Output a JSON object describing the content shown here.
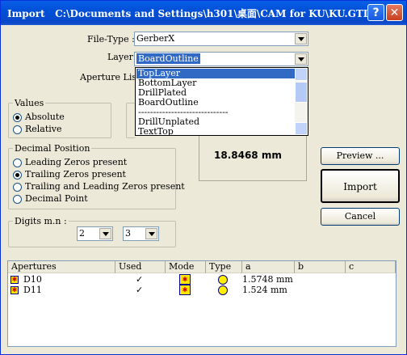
{
  "window": {
    "title": "Import   C:\\Documents and Settings\\h301\\桌面\\CAM for KU\\KU.GTL",
    "help": "?",
    "close": "✕"
  },
  "filetype": {
    "label": "File-Type :",
    "value": "GerberX"
  },
  "layer": {
    "label": "Layer",
    "value": "BoardOutline",
    "options": [
      "TopLayer",
      "BottomLayer",
      "DrillPlated",
      "BoardOutline",
      "------------------------------",
      "DrillUnplated",
      "TextTop"
    ]
  },
  "aperture_list": {
    "label": "Aperture List"
  },
  "values": {
    "title": "Values",
    "absolute": "Absolute",
    "relative": "Relative"
  },
  "decimal": {
    "title": "Decimal Position",
    "options": [
      "Leading Zeros present",
      "Trailing Zeros present",
      "Trailing and Leading Zeros present",
      "Decimal Point"
    ],
    "selected": 1
  },
  "digits": {
    "title": "Digits  m.n :",
    "m": "2",
    "n": "3"
  },
  "measure": "18.8468 mm",
  "buttons": {
    "preview": "Preview ...",
    "import": "Import",
    "cancel": "Cancel"
  },
  "table": {
    "headers": [
      "Apertures",
      "Used",
      "Mode",
      "Type",
      "a",
      "b",
      "c"
    ],
    "rows": [
      {
        "name": "D10",
        "used": "✓",
        "a": "1.5748 mm",
        "b": "",
        "c": ""
      },
      {
        "name": "D11",
        "used": "✓",
        "a": "1.524 mm",
        "b": "",
        "c": ""
      }
    ]
  },
  "colors": {
    "title_bar": "#0a5fe6",
    "selection": "#316ac5",
    "icon_fill": "#ffe600"
  }
}
